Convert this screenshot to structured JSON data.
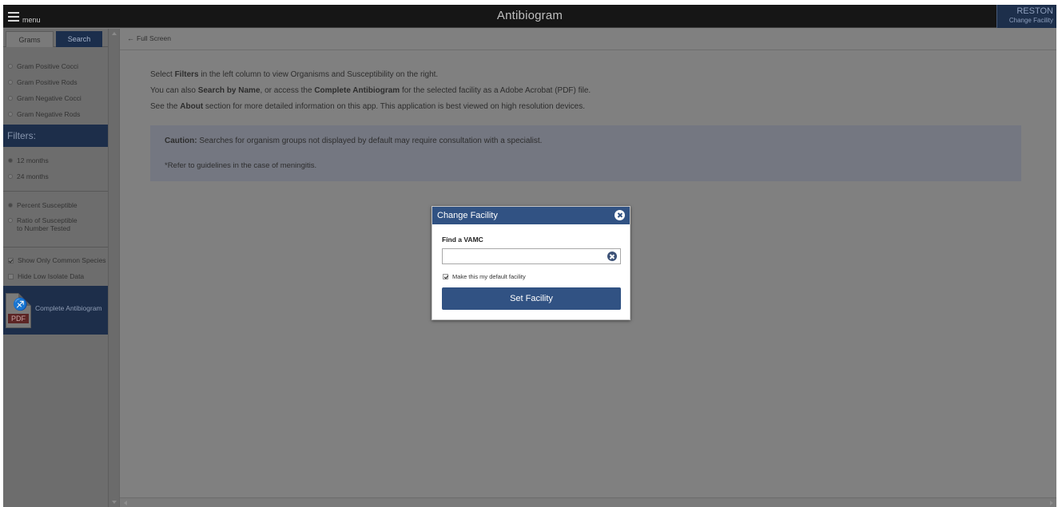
{
  "header": {
    "menu_label": "menu",
    "title": "Antibiogram",
    "facility_name": "RESTON",
    "change_facility_label": "Change Facility"
  },
  "sidebar": {
    "tabs": [
      {
        "label": "Grams",
        "active": false
      },
      {
        "label": "Search",
        "active": true
      }
    ],
    "gram_options": [
      {
        "label": "Gram Positive Cocci"
      },
      {
        "label": "Gram Positive Rods"
      },
      {
        "label": "Gram Negative Cocci"
      },
      {
        "label": "Gram Negative Rods"
      }
    ],
    "filters_heading": "Filters:",
    "period_options": [
      {
        "label": "12 months",
        "selected": true
      },
      {
        "label": "24 months",
        "selected": false
      }
    ],
    "measure_options": [
      {
        "label": "Percent Susceptible",
        "selected": true
      },
      {
        "label_line1": "Ratio of Susceptible",
        "label_line2": "to Number Tested",
        "selected": false
      }
    ],
    "check_options": [
      {
        "label": "Show Only Common Species",
        "checked": true
      },
      {
        "label": "Hide Low Isolate Data",
        "checked": false
      }
    ],
    "pdf": {
      "icon_text": "PDF",
      "label": "Complete Antibiogram"
    }
  },
  "main": {
    "fullscreen_label": "Full Screen",
    "intro": {
      "line1_pre": "Select ",
      "line1_bold": "Filters",
      "line1_post": " in the left column to view Organisms and Susceptibility on the right.",
      "line2_pre": "You can also ",
      "line2_bold1": "Search by Name",
      "line2_mid": ", or access the ",
      "line2_bold2": "Complete Antibiogram",
      "line2_post": " for the selected facility as a Adobe Acrobat (PDF) file.",
      "line3_pre": "See the ",
      "line3_bold": "About",
      "line3_post": " section for more detailed information on this app. This application is best viewed on high resolution devices."
    },
    "caution": {
      "bold": "Caution:",
      "text": " Searches for organism groups not displayed by default may require consultation with a specialist.",
      "note": "*Refer to guidelines in the case of meningitis."
    }
  },
  "modal": {
    "title": "Change Facility",
    "find_label": "Find a VAMC",
    "input_value": "",
    "input_placeholder": "",
    "default_label": "Make this my default facility",
    "default_checked": true,
    "button_label": "Set Facility"
  },
  "colors": {
    "nav_dark": "#161616",
    "accent_blue": "#315283",
    "sidebar_highlight": "#1d2e4a"
  }
}
